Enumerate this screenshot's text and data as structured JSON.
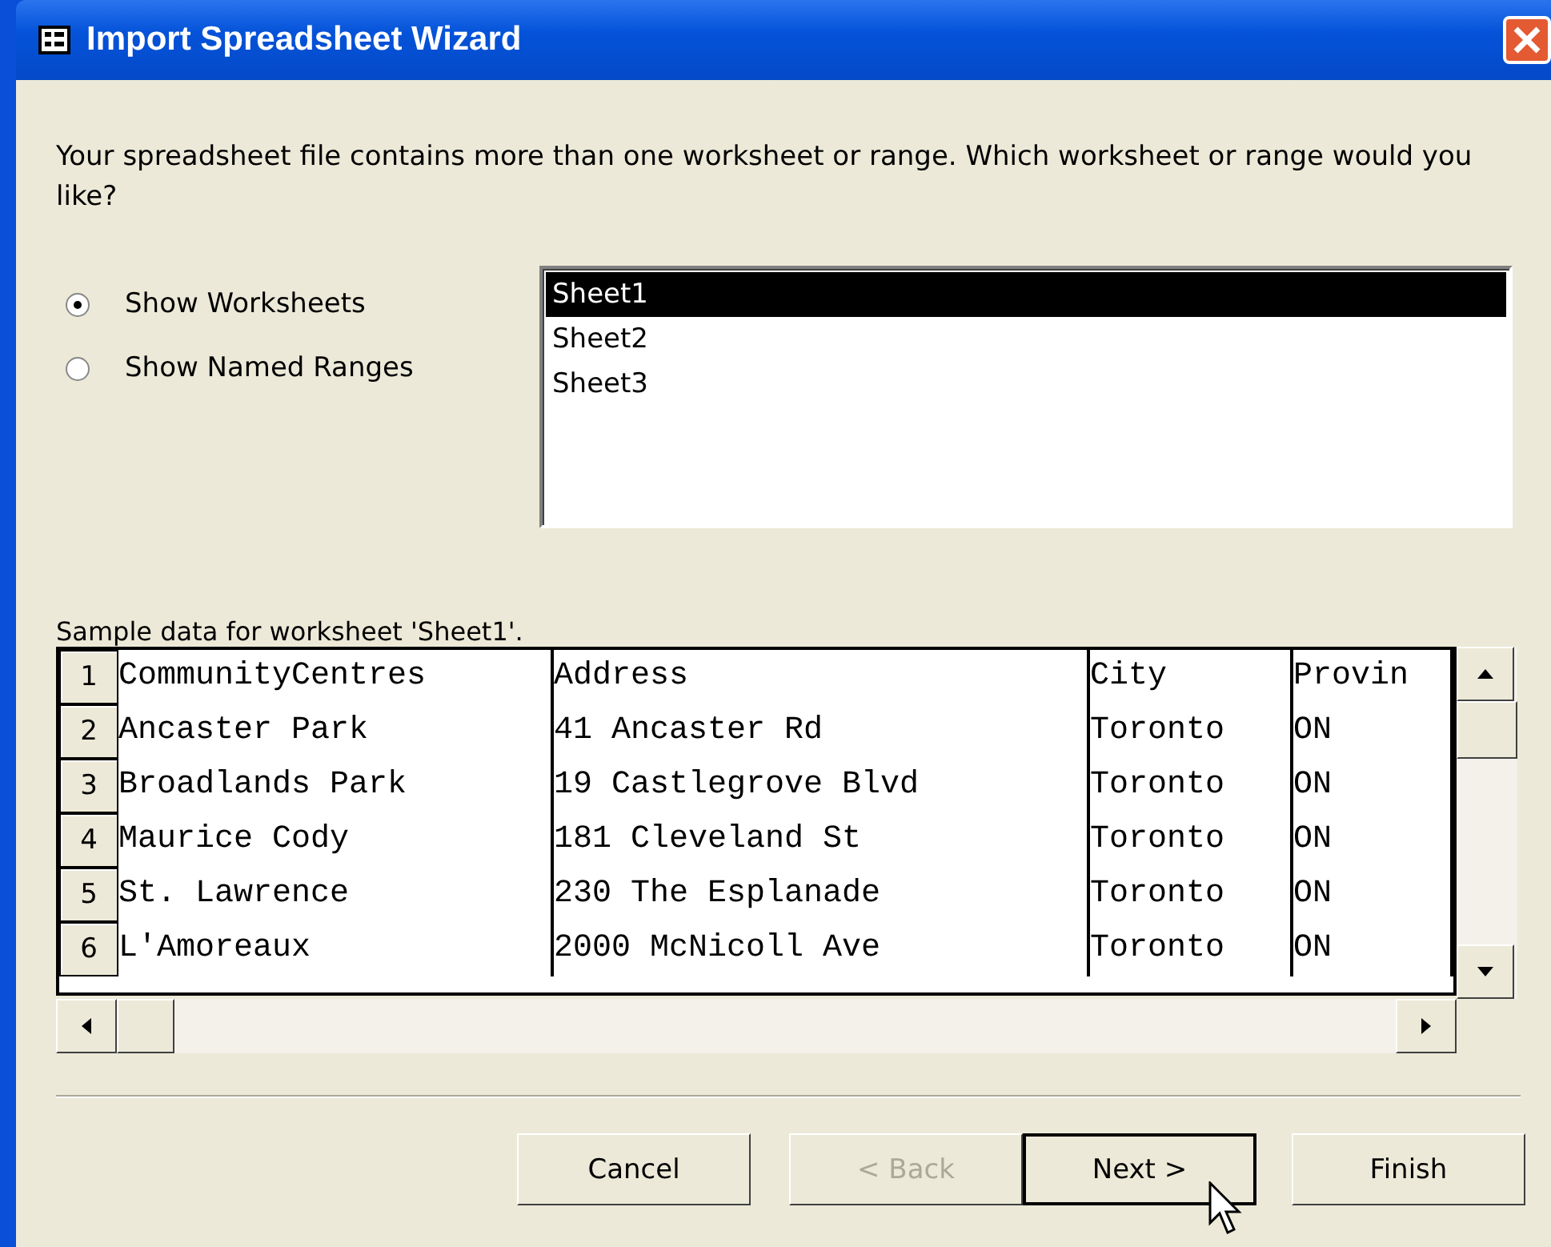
{
  "window": {
    "title": "Import Spreadsheet Wizard"
  },
  "prompt": "Your spreadsheet file contains more than one worksheet or range. Which worksheet or range would you like?",
  "view_options": [
    {
      "label": "Show Worksheets",
      "selected": true
    },
    {
      "label": "Show Named Ranges",
      "selected": false
    }
  ],
  "worksheets": [
    {
      "label": "Sheet1",
      "selected": true
    },
    {
      "label": "Sheet2",
      "selected": false
    },
    {
      "label": "Sheet3",
      "selected": false
    }
  ],
  "sample": {
    "caption": "Sample data for worksheet 'Sheet1'.",
    "rows": [
      {
        "number": "1",
        "cells": [
          "CommunityCentres",
          "Address",
          "City",
          "Provin"
        ]
      },
      {
        "number": "2",
        "cells": [
          "Ancaster Park",
          "41 Ancaster Rd",
          "Toronto",
          "ON"
        ]
      },
      {
        "number": "3",
        "cells": [
          "Broadlands Park",
          "19 Castlegrove Blvd",
          "Toronto",
          "ON"
        ]
      },
      {
        "number": "4",
        "cells": [
          "Maurice Cody",
          "181 Cleveland St",
          "Toronto",
          "ON"
        ]
      },
      {
        "number": "5",
        "cells": [
          "St. Lawrence",
          "230 The Esplanade",
          "Toronto",
          "ON"
        ]
      },
      {
        "number": "6",
        "cells": [
          "L'Amoreaux",
          "2000 McNicoll Ave",
          "Toronto",
          "ON"
        ]
      }
    ]
  },
  "buttons": [
    {
      "label": "Cancel",
      "disabled": false,
      "default": false
    },
    {
      "label": "< Back",
      "disabled": true,
      "default": false
    },
    {
      "label": "Next >",
      "disabled": false,
      "default": true
    },
    {
      "label": "Finish",
      "disabled": false,
      "default": false
    }
  ]
}
